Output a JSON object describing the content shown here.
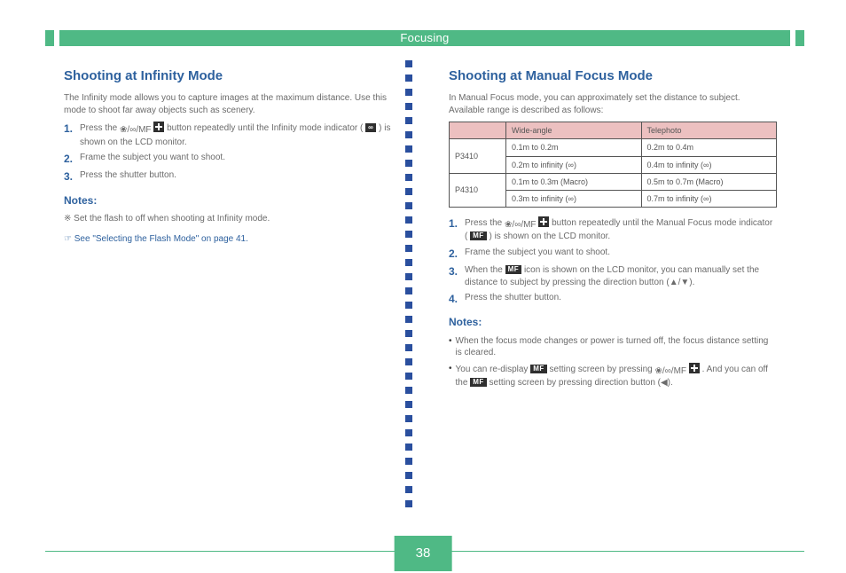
{
  "banner_title": "Focusing",
  "page_number": "38",
  "left": {
    "heading": "Shooting at Infinity Mode",
    "intro": "The Infinity mode allows you to capture images at the maximum distance. Use this mode to shoot far away objects such as scenery.",
    "steps": [
      {
        "num": "1.",
        "body_pre": "Press the ",
        "body_post": " button repeatedly until the Infinity mode indicator (",
        "body_end": ") is shown on the LCD monitor."
      },
      {
        "num": "2.",
        "body_pre": "Frame the subject you want to shoot.",
        "body_post": "",
        "body_end": ""
      },
      {
        "num": "3.",
        "body_pre": "Press the shutter button.",
        "body_post": "",
        "body_end": ""
      }
    ],
    "mode_btn": "❀/∞/MF",
    "inf_icon": "∞",
    "note": "Set the flash to off when shooting at Infinity mode.",
    "seealso": "See \"Selecting the Flash Mode\" on page 41."
  },
  "right": {
    "heading": "Shooting at Manual Focus Mode",
    "intro": "In Manual Focus mode, you can approximately set the distance to subject. Available range is described as follows:",
    "table": {
      "header": [
        "",
        "Wide-angle",
        "Telephoto"
      ],
      "rows": [
        {
          "label": "P3410",
          "cells": [
            [
              "0.1m to 0.2m",
              "0.2m to 0.4m"
            ],
            [
              "0.2m to infinity (∞)",
              "0.4m to infinity (∞)"
            ]
          ]
        },
        {
          "label": "P4310",
          "cells": [
            [
              "0.1m to 0.3m (Macro)",
              "0.5m to 0.7m (Macro)"
            ],
            [
              "0.3m to infinity (∞)",
              "0.7m to infinity (∞)"
            ]
          ]
        }
      ]
    },
    "steps": [
      {
        "num": "1.",
        "pre": "Press the ",
        "mid": " button repeatedly until the Manual Focus mode indicator (",
        "end": ") is shown on the LCD monitor."
      },
      {
        "num": "2.",
        "pre": "Frame the subject you want to shoot."
      },
      {
        "num": "3.",
        "pre": "When the ",
        "mid": " icon is shown on the LCD monitor, you can manually set the distance to subject by pressing the direction button (▲/▼)."
      },
      {
        "num": "4.",
        "pre": "Press the shutter button."
      }
    ],
    "mode_btn": "❀/∞/MF",
    "mf_label": "MF",
    "bullets": [
      "When the focus mode changes or power is turned off, the focus distance setting is cleared.",
      {
        "pre": "You can re-display ",
        "mid": " setting screen by pressing ",
        "end": ". And you can off the ",
        "last": " setting screen by pressing direction button (◀)."
      }
    ]
  }
}
